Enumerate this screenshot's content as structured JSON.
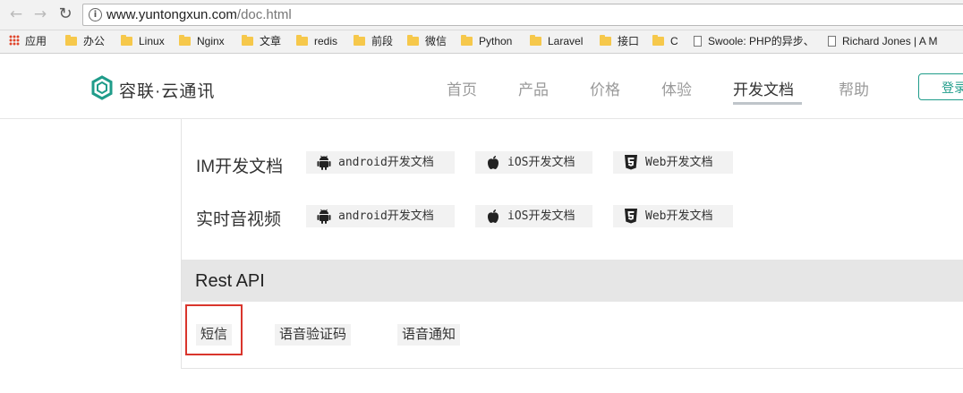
{
  "browser": {
    "url_host": "www.yuntongxun.com",
    "url_path": "/doc.html",
    "bookmarks": [
      {
        "label": "应用",
        "icon": "apps-grid-icon"
      },
      {
        "label": "办公",
        "icon": "folder-icon"
      },
      {
        "label": "Linux",
        "icon": "folder-icon"
      },
      {
        "label": "Nginx",
        "icon": "folder-icon"
      },
      {
        "label": "文章",
        "icon": "folder-icon"
      },
      {
        "label": "redis",
        "icon": "folder-icon"
      },
      {
        "label": "前段",
        "icon": "folder-icon"
      },
      {
        "label": "微信",
        "icon": "folder-icon"
      },
      {
        "label": "Python",
        "icon": "folder-icon"
      },
      {
        "label": "Laravel",
        "icon": "folder-icon"
      },
      {
        "label": "接口",
        "icon": "folder-icon"
      },
      {
        "label": "C",
        "icon": "folder-icon"
      },
      {
        "label": "Swoole: PHP的异步、",
        "icon": "page-icon"
      },
      {
        "label": "Richard Jones | A M",
        "icon": "page-icon"
      }
    ]
  },
  "site": {
    "logo_text": "容联·云通讯",
    "brand_color": "#1f9c8a",
    "nav": [
      {
        "label": "首页",
        "active": false
      },
      {
        "label": "产品",
        "active": false
      },
      {
        "label": "价格",
        "active": false
      },
      {
        "label": "体验",
        "active": false
      },
      {
        "label": "开发文档",
        "active": true
      },
      {
        "label": "帮助",
        "active": false
      }
    ],
    "login_label": "登录"
  },
  "docs": {
    "rows": [
      {
        "title": "IM开发文档",
        "buttons": [
          {
            "label": "android开发文档",
            "icon": "android-icon"
          },
          {
            "label": "iOS开发文档",
            "icon": "apple-icon"
          },
          {
            "label": "Web开发文档",
            "icon": "html5-icon"
          }
        ]
      },
      {
        "title": "实时音视频",
        "buttons": [
          {
            "label": "android开发文档",
            "icon": "android-icon"
          },
          {
            "label": "iOS开发文档",
            "icon": "apple-icon"
          },
          {
            "label": "Web开发文档",
            "icon": "html5-icon"
          }
        ]
      }
    ],
    "rest_title": "Rest API",
    "rest_items": [
      "短信",
      "语音验证码",
      "语音通知"
    ],
    "highlight_color": "#d9352c"
  }
}
